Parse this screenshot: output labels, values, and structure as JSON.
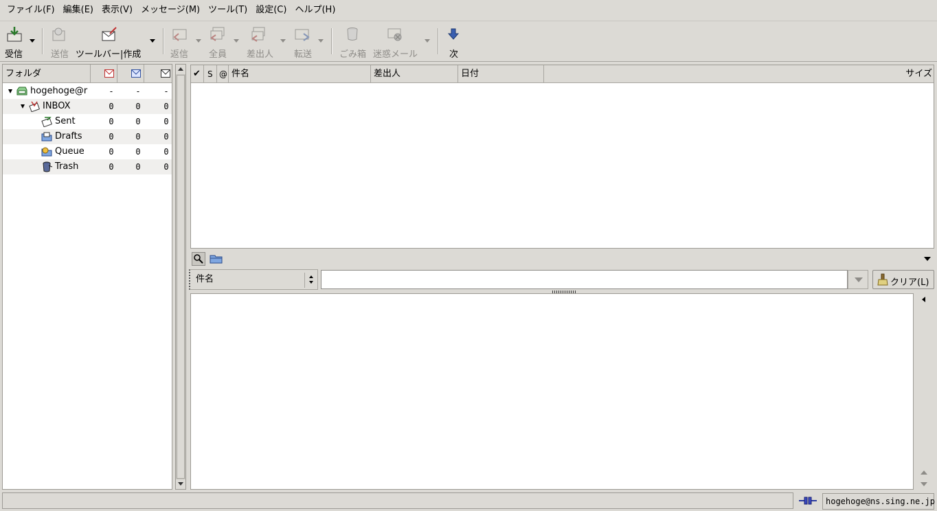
{
  "menubar": {
    "items": [
      "ファイル(F)",
      "編集(E)",
      "表示(V)",
      "メッセージ(M)",
      "ツール(T)",
      "設定(C)",
      "ヘルプ(H)"
    ]
  },
  "toolbar": {
    "receive": "受信",
    "send": "送信",
    "compose": "ツールバー|作成",
    "reply": "返信",
    "reply_all": "全員",
    "reply_sender": "差出人",
    "forward": "転送",
    "trash": "ごみ箱",
    "junk": "迷惑メール",
    "next": "次"
  },
  "folder_pane": {
    "header": "フォルダ",
    "folders": [
      {
        "name": "hogehoge@r",
        "new": "-",
        "unread": "-",
        "total": "-",
        "icon": "mailbox-icon"
      },
      {
        "name": "INBOX",
        "new": "0",
        "unread": "0",
        "total": "0",
        "icon": "inbox-icon"
      },
      {
        "name": "Sent",
        "new": "0",
        "unread": "0",
        "total": "0",
        "icon": "sent-icon"
      },
      {
        "name": "Drafts",
        "new": "0",
        "unread": "0",
        "total": "0",
        "icon": "drafts-icon"
      },
      {
        "name": "Queue",
        "new": "0",
        "unread": "0",
        "total": "0",
        "icon": "queue-icon"
      },
      {
        "name": "Trash",
        "new": "0",
        "unread": "0",
        "total": "0",
        "icon": "trash-icon"
      }
    ]
  },
  "message_list": {
    "columns": {
      "mark": "✔",
      "status": "S",
      "attachment": "@",
      "subject": "件名",
      "from": "差出人",
      "date": "日付",
      "size": "サイズ"
    }
  },
  "quick_search": {
    "type": "件名",
    "value": "",
    "clear": "クリア(L)"
  },
  "statusbar": {
    "message": "",
    "account": "hogehoge@ns.sing.ne.jp"
  }
}
